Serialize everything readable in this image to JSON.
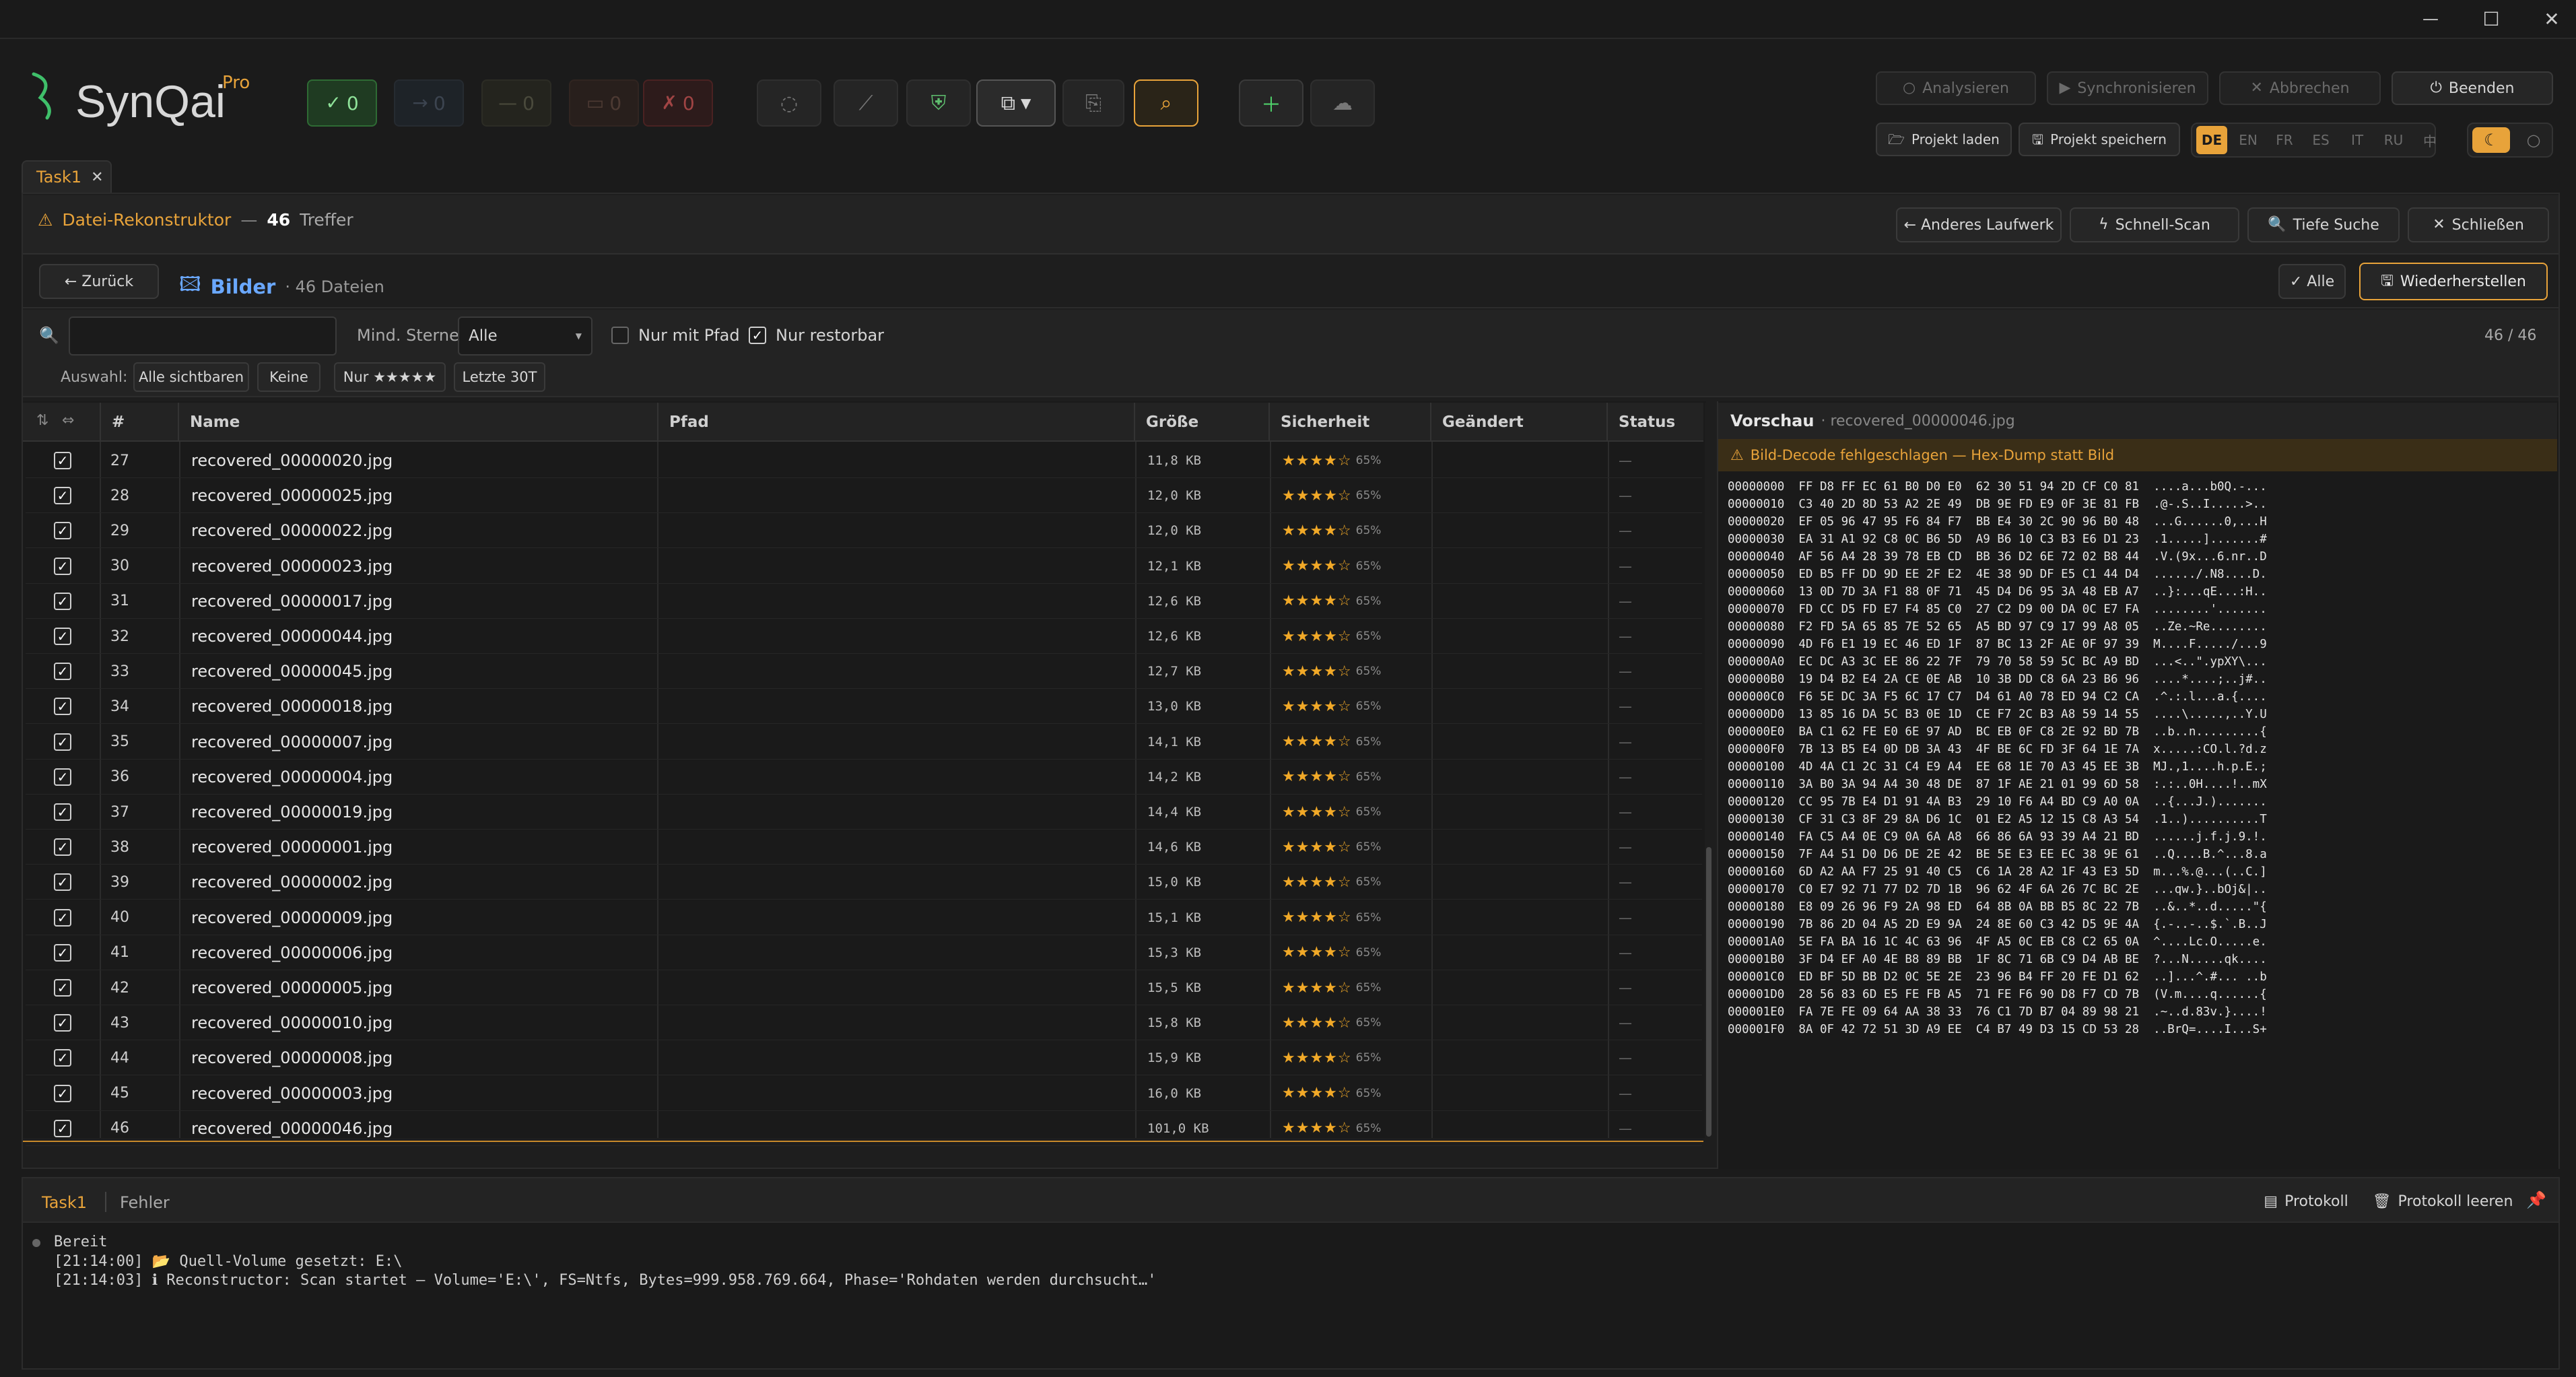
{
  "window": {
    "minimize": "—",
    "maximize": "☐",
    "close": "✕"
  },
  "brand": {
    "name": "SynQai",
    "edition": "Pro"
  },
  "status_counts": {
    "ok": "0",
    "skip": "0",
    "pending": "0",
    "warn": "0",
    "err": "0"
  },
  "top_actions": {
    "analyze": "Analysieren",
    "sync": "Synchronisieren",
    "abort": "Abbrechen",
    "quit": "Beenden",
    "load_project": "Projekt laden",
    "save_project": "Projekt speichern"
  },
  "languages": [
    "DE",
    "EN",
    "FR",
    "ES",
    "IT",
    "RU",
    "中"
  ],
  "tab": {
    "label": "Task1"
  },
  "reconstructor": {
    "title": "Datei-Rekonstruktor",
    "sep": "—",
    "count": "46",
    "count_label": "Treffer",
    "other_drive": "← Anderes Laufwerk",
    "quick_scan": "Schnell-Scan",
    "deep_search": "Tiefe Suche",
    "close": "Schließen"
  },
  "category": {
    "back": "← Zurück",
    "name": "Bilder",
    "count": "· 46 Dateien",
    "all": "✓ Alle",
    "restore": "Wiederherstellen"
  },
  "filter": {
    "search_placeholder": "",
    "min_stars_label": "Mind. Sterne:",
    "min_stars_value": "Alle",
    "only_path": "Nur mit Pfad",
    "only_restorable": "Nur restorbar",
    "counter": "46 / 46",
    "selection_label": "Auswahl:",
    "sel_all_visible": "Alle sichtbaren",
    "sel_none": "Keine",
    "sel_five_stars": "Nur ★★★★★",
    "sel_last30": "Letzte 30T"
  },
  "columns": {
    "num": "#",
    "name": "Name",
    "path": "Pfad",
    "size": "Größe",
    "confidence": "Sicherheit",
    "modified": "Geändert",
    "status": "Status"
  },
  "rows": [
    {
      "n": "27",
      "name": "recovered_00000020.jpg",
      "size": "11,8 KB",
      "stars": "★★★★☆",
      "pct": "65%",
      "status": "—"
    },
    {
      "n": "28",
      "name": "recovered_00000025.jpg",
      "size": "12,0 KB",
      "stars": "★★★★☆",
      "pct": "65%",
      "status": "—"
    },
    {
      "n": "29",
      "name": "recovered_00000022.jpg",
      "size": "12,0 KB",
      "stars": "★★★★☆",
      "pct": "65%",
      "status": "—"
    },
    {
      "n": "30",
      "name": "recovered_00000023.jpg",
      "size": "12,1 KB",
      "stars": "★★★★☆",
      "pct": "65%",
      "status": "—"
    },
    {
      "n": "31",
      "name": "recovered_00000017.jpg",
      "size": "12,6 KB",
      "stars": "★★★★☆",
      "pct": "65%",
      "status": "—"
    },
    {
      "n": "32",
      "name": "recovered_00000044.jpg",
      "size": "12,6 KB",
      "stars": "★★★★☆",
      "pct": "65%",
      "status": "—"
    },
    {
      "n": "33",
      "name": "recovered_00000045.jpg",
      "size": "12,7 KB",
      "stars": "★★★★☆",
      "pct": "65%",
      "status": "—"
    },
    {
      "n": "34",
      "name": "recovered_00000018.jpg",
      "size": "13,0 KB",
      "stars": "★★★★☆",
      "pct": "65%",
      "status": "—"
    },
    {
      "n": "35",
      "name": "recovered_00000007.jpg",
      "size": "14,1 KB",
      "stars": "★★★★☆",
      "pct": "65%",
      "status": "—"
    },
    {
      "n": "36",
      "name": "recovered_00000004.jpg",
      "size": "14,2 KB",
      "stars": "★★★★☆",
      "pct": "65%",
      "status": "—"
    },
    {
      "n": "37",
      "name": "recovered_00000019.jpg",
      "size": "14,4 KB",
      "stars": "★★★★☆",
      "pct": "65%",
      "status": "—"
    },
    {
      "n": "38",
      "name": "recovered_00000001.jpg",
      "size": "14,6 KB",
      "stars": "★★★★☆",
      "pct": "65%",
      "status": "—"
    },
    {
      "n": "39",
      "name": "recovered_00000002.jpg",
      "size": "15,0 KB",
      "stars": "★★★★☆",
      "pct": "65%",
      "status": "—"
    },
    {
      "n": "40",
      "name": "recovered_00000009.jpg",
      "size": "15,1 KB",
      "stars": "★★★★☆",
      "pct": "65%",
      "status": "—"
    },
    {
      "n": "41",
      "name": "recovered_00000006.jpg",
      "size": "15,3 KB",
      "stars": "★★★★☆",
      "pct": "65%",
      "status": "—"
    },
    {
      "n": "42",
      "name": "recovered_00000005.jpg",
      "size": "15,5 KB",
      "stars": "★★★★☆",
      "pct": "65%",
      "status": "—"
    },
    {
      "n": "43",
      "name": "recovered_00000010.jpg",
      "size": "15,8 KB",
      "stars": "★★★★☆",
      "pct": "65%",
      "status": "—"
    },
    {
      "n": "44",
      "name": "recovered_00000008.jpg",
      "size": "15,9 KB",
      "stars": "★★★★☆",
      "pct": "65%",
      "status": "—"
    },
    {
      "n": "45",
      "name": "recovered_00000003.jpg",
      "size": "16,0 KB",
      "stars": "★★★★☆",
      "pct": "65%",
      "status": "—"
    },
    {
      "n": "46",
      "name": "recovered_00000046.jpg",
      "size": "101,0 KB",
      "stars": "★★★★☆",
      "pct": "65%",
      "status": "—"
    }
  ],
  "preview": {
    "title": "Vorschau",
    "file": "· recovered_00000046.jpg",
    "warning": "Bild-Decode fehlgeschlagen — Hex-Dump statt Bild",
    "hex": [
      "00000000  FF D8 FF EC 61 B0 D0 E0  62 30 51 94 2D CF C0 81  ....a...b0Q.-...",
      "00000010  C3 40 2D 8D 53 A2 2E 49  DB 9E FD E9 0F 3E 81 FB  .@-.S..I.....>..",
      "00000020  EF 05 96 47 95 F6 84 F7  BB E4 30 2C 90 96 B0 48  ...G......0,...H",
      "00000030  EA 31 A1 92 C8 0C B6 5D  A9 B6 10 C3 B3 E6 D1 23  .1.....].......#",
      "00000040  AF 56 A4 28 39 78 EB CD  BB 36 D2 6E 72 02 B8 44  .V.(9x...6.nr..D",
      "00000050  ED B5 FF DD 9D EE 2F E2  4E 38 9D DF E5 C1 44 D4  ....../.N8....D.",
      "00000060  13 0D 7D 3A F1 88 0F 71  45 D4 D6 95 3A 48 EB A7  ..}:...qE...:H..",
      "00000070  FD CC D5 FD E7 F4 85 C0  27 C2 D9 00 DA 0C E7 FA  ........'.......",
      "00000080  F2 FD 5A 65 85 7E 52 65  A5 BD 97 C9 17 99 A8 05  ..Ze.~Re........",
      "00000090  4D F6 E1 19 EC 46 ED 1F  87 BC 13 2F AE 0F 97 39  M....F...../...9",
      "000000A0  EC DC A3 3C EE 86 22 7F  79 70 58 59 5C BC A9 BD  ...<..\".ypXY\\...",
      "000000B0  19 D4 B2 E4 2A CE 0E AB  10 3B DD C8 6A 23 B6 96  ....*....;..j#..",
      "000000C0  F6 5E DC 3A F5 6C 17 C7  D4 61 A0 78 ED 94 C2 CA  .^.:.l...a.{....",
      "000000D0  13 85 16 DA 5C B3 0E 1D  CE F7 2C B3 A8 59 14 55  ....\\.....,..Y.U",
      "000000E0  BA C1 62 FE E0 6E 97 AD  BC EB 0F C8 2E 92 BD 7B  ..b..n.........{",
      "000000F0  7B 13 B5 E4 0D DB 3A 43  4F BE 6C FD 3F 64 1E 7A  x.....:CO.l.?d.z",
      "00000100  4D 4A C1 2C 31 C4 E9 A4  EE 68 1E 70 A3 45 EE 3B  MJ.,1....h.p.E.;",
      "00000110  3A B0 3A 94 A4 30 48 DE  87 1F AE 21 01 99 6D 58  :.:..0H....!..mX",
      "00000120  CC 95 7B E4 D1 91 4A B3  29 10 F6 A4 BD C9 A0 0A  ..{...J.).......",
      "00000130  CF 31 C3 8F 29 8A D6 1C  01 E2 A5 12 15 C8 A3 54  .1..)..........T",
      "00000140  FA C5 A4 0E C9 0A 6A A8  66 86 6A 93 39 A4 21 BD  ......j.f.j.9.!.",
      "00000150  7F A4 51 D0 D6 DE 2E 42  BE 5E E3 EE EC 38 9E 61  ..Q....B.^...8.a",
      "00000160  6D A2 AA F7 25 91 40 C5  C6 1A 28 A2 1F 43 E3 5D  m...%.@...(..C.]",
      "00000170  C0 E7 92 71 77 D2 7D 1B  96 62 4F 6A 26 7C BC 2E  ...qw.}..bOj&|..",
      "00000180  E8 09 26 96 F9 2A 98 ED  64 8B 0A BB B5 8C 22 7B  ..&..*..d.....\"{",
      "00000190  7B 86 2D 04 A5 2D E9 9A  24 8E 60 C3 42 D5 9E 4A  {.-..-..$.`.B..J",
      "000001A0  5E FA BA 16 1C 4C 63 96  4F A5 0C EB C8 C2 65 0A  ^....Lc.O.....e.",
      "000001B0  3F D4 EF A0 4E B8 89 BB  1F 8C 71 6B C9 D4 AB BE  ?...N.....qk....",
      "000001C0  ED BF 5D BB D2 0C 5E 2E  23 96 B4 FF 20 FE D1 62  ..]...^.#... ..b",
      "000001D0  28 56 83 6D E5 FE FB A5  71 FE F6 90 D8 F7 CD 7B  (V.m....q......{",
      "000001E0  FA 7E FE 09 64 AA 38 33  76 C1 7D B7 04 89 98 21  .~..d.83v.}....!",
      "000001F0  8A 0F 42 72 51 3D A9 EE  C4 B7 49 D3 15 CD 53 28  ..BrQ=....I...S+"
    ]
  },
  "bottom": {
    "tab_task": "Task1",
    "tab_errors": "Fehler",
    "log_button": "Protokoll",
    "clear_log_button": "Protokoll leeren",
    "state": "Bereit",
    "log": [
      "[21:14:00] 📂 Quell-Volume gesetzt: E:\\",
      "[21:14:03] ℹ Reconstructor: Scan startet — Volume='E:\\', FS=Ntfs, Bytes=999.958.769.664, Phase='Rohdaten werden durchsucht…'"
    ]
  },
  "colors": {
    "accent": "#e8a33a",
    "ok": "#4caf50",
    "star": "#f1a928",
    "link": "#6aa8ff"
  }
}
